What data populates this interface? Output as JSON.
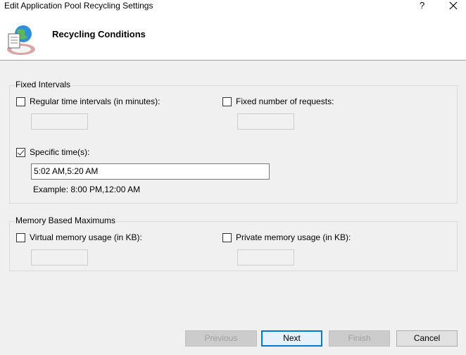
{
  "window": {
    "title": "Edit Application Pool Recycling Settings",
    "help": "?"
  },
  "header": {
    "heading": "Recycling Conditions"
  },
  "fixed_intervals": {
    "title": "Fixed Intervals",
    "regular_time": {
      "label": "Regular time intervals (in minutes):",
      "checked": false,
      "value": ""
    },
    "fixed_requests": {
      "label": "Fixed number of requests:",
      "checked": false,
      "value": ""
    },
    "specific_times": {
      "label": "Specific time(s):",
      "checked": true,
      "value": "5:02 AM,5:20 AM"
    },
    "example": "Example: 8:00 PM,12:00 AM"
  },
  "memory": {
    "title": "Memory Based Maximums",
    "virtual": {
      "label": "Virtual memory usage (in KB):",
      "checked": false,
      "value": ""
    },
    "private": {
      "label": "Private memory usage (in KB):",
      "checked": false,
      "value": ""
    }
  },
  "buttons": {
    "previous": "Previous",
    "next": "Next",
    "finish": "Finish",
    "cancel": "Cancel"
  }
}
